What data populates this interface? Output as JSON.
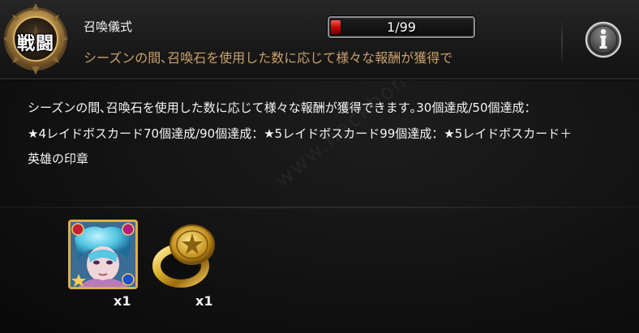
{
  "header": {
    "badge_label": "戦闘",
    "title": "召喚儀式",
    "subtitle": "シーズンの間､召喚石を使用した数に応じて様々な報酬が獲得で",
    "progress_text": "1/99",
    "progress_fraction": 0.0101
  },
  "description": {
    "line1": "シーズンの間､召喚石を使用した数に応じて様々な報酬が獲得できます｡30個達成/50個達成：",
    "line2": "★4レイドボスカード70個達成/90個達成：★5レイドボスカード99個達成：★5レイドボスカード＋",
    "line3": "英雄の印章"
  },
  "rewards": [
    {
      "name": "raid-boss-card",
      "count": "x1"
    },
    {
      "name": "hero-seal-ring",
      "count": "x1"
    }
  ],
  "watermark": "www.hackhome.com 网侠手机站",
  "colors": {
    "subtitle": "#c9a06a",
    "progress_fill": "#d40000",
    "badge_gold": "#b8904a",
    "card_border": "#d9b04a"
  }
}
